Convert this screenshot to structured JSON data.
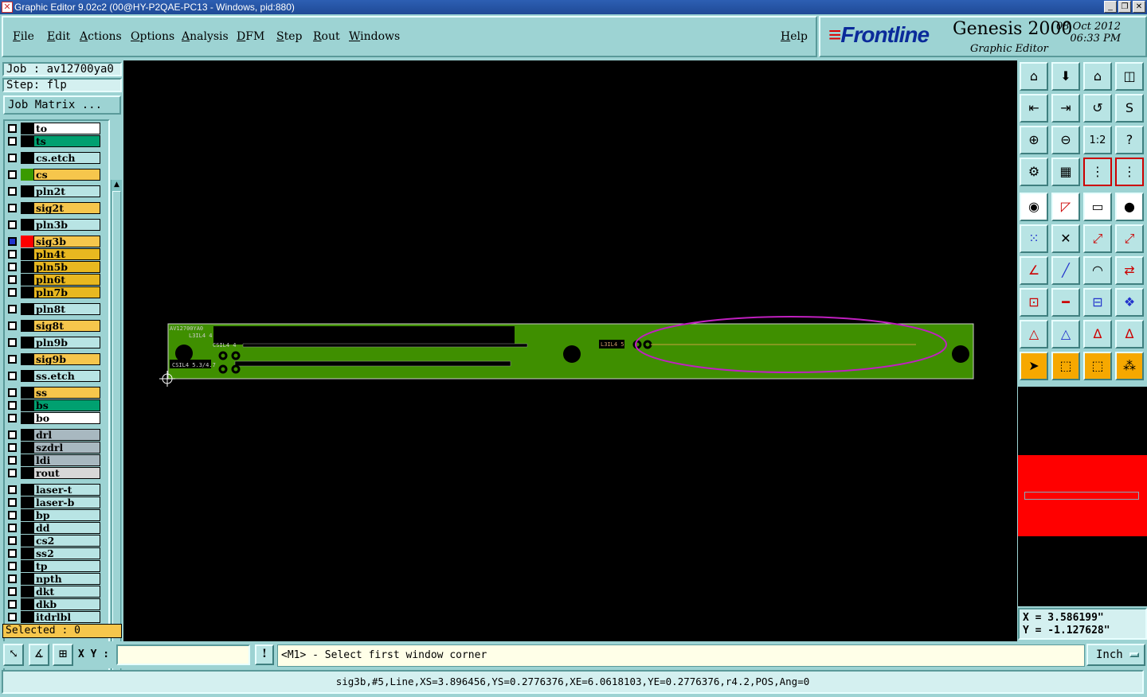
{
  "window": {
    "title": "Graphic Editor 9.02c2 (00@HY-P2QAE-PC13 - Windows, pid:880)"
  },
  "menu": {
    "items": [
      "File",
      "Edit",
      "Actions",
      "Options",
      "Analysis",
      "DFM",
      "Step",
      "Rout",
      "Windows"
    ],
    "help": "Help"
  },
  "brand": {
    "logo": "Frontline",
    "product": "Genesis 2000",
    "subtitle": "Graphic Editor",
    "date": "08 Oct 2012",
    "time": "06:33 PM"
  },
  "job": {
    "job_label": "Job : av12700ya0",
    "step_label": "Step: flp",
    "matrix_button": "Job Matrix ..."
  },
  "layers": [
    {
      "name": "to",
      "color": "#ffffff"
    },
    {
      "name": "ts",
      "color": "#00a070"
    },
    {
      "name": "cs.etch",
      "color": "#b8e4e4"
    },
    {
      "name": "cs",
      "color": "#f6c64c",
      "swatch": "#3a9a00"
    },
    {
      "name": "pln2t",
      "color": "#b8e4e4"
    },
    {
      "name": "sig2t",
      "color": "#f6c64c"
    },
    {
      "name": "pln3b",
      "color": "#b8e4e4"
    },
    {
      "name": "sig3b",
      "color": "#f6c64c",
      "swatch": "#ff0000",
      "active": true
    },
    {
      "name": "pln4t",
      "color": "#e8b820"
    },
    {
      "name": "pln5b",
      "color": "#e8b820"
    },
    {
      "name": "pln6t",
      "color": "#e8b820"
    },
    {
      "name": "pln7b",
      "color": "#e8b820"
    },
    {
      "name": "pln8t",
      "color": "#b8e4e4"
    },
    {
      "name": "sig8t",
      "color": "#f6c64c"
    },
    {
      "name": "pln9b",
      "color": "#b8e4e4"
    },
    {
      "name": "sig9b",
      "color": "#f6c64c"
    },
    {
      "name": "ss.etch",
      "color": "#b8e4e4"
    },
    {
      "name": "ss",
      "color": "#f6c64c"
    },
    {
      "name": "bs",
      "color": "#00a070"
    },
    {
      "name": "bo",
      "color": "#ffffff"
    },
    {
      "name": "drl",
      "color": "#a8b8c0"
    },
    {
      "name": "szdrl",
      "color": "#a8b8c0"
    },
    {
      "name": "ldi",
      "color": "#a8b8c0"
    },
    {
      "name": "rout",
      "color": "#d8d8d8"
    },
    {
      "name": "laser-t",
      "color": "#b8e4e4"
    },
    {
      "name": "laser-b",
      "color": "#b8e4e4"
    },
    {
      "name": "bp",
      "color": "#b8e4e4"
    },
    {
      "name": "dd",
      "color": "#b8e4e4"
    },
    {
      "name": "cs2",
      "color": "#b8e4e4"
    },
    {
      "name": "ss2",
      "color": "#b8e4e4"
    },
    {
      "name": "tp",
      "color": "#b8e4e4"
    },
    {
      "name": "npth",
      "color": "#b8e4e4"
    },
    {
      "name": "dkt",
      "color": "#b8e4e4"
    },
    {
      "name": "dkb",
      "color": "#b8e4e4"
    },
    {
      "name": "itdrlbl",
      "color": "#b8e4e4"
    }
  ],
  "selected": "Selected : 0",
  "board": {
    "label1": "AV12700YA0",
    "label2": "L3IL4 4",
    "label3": "CSIL4 4",
    "label4": "CSIL4 5.3/4.7",
    "label5": "L3IL4 5"
  },
  "coords": {
    "x": "X = 3.586199\"",
    "y": "Y = -1.127628\""
  },
  "cmd": {
    "xy_label": "X Y :",
    "xy_value": "",
    "prompt": "<M1> - Select first window corner",
    "unit": "Inch"
  },
  "status_line": "sig3b,#5,Line,XS=3.896456,YS=0.2776376,XE=6.0618103,YE=0.2776376,r4.2,POS,Ang=0",
  "colors": {
    "board": "#3f8f00",
    "highlight": "#c020c0",
    "panel": "#9dd3d3"
  }
}
